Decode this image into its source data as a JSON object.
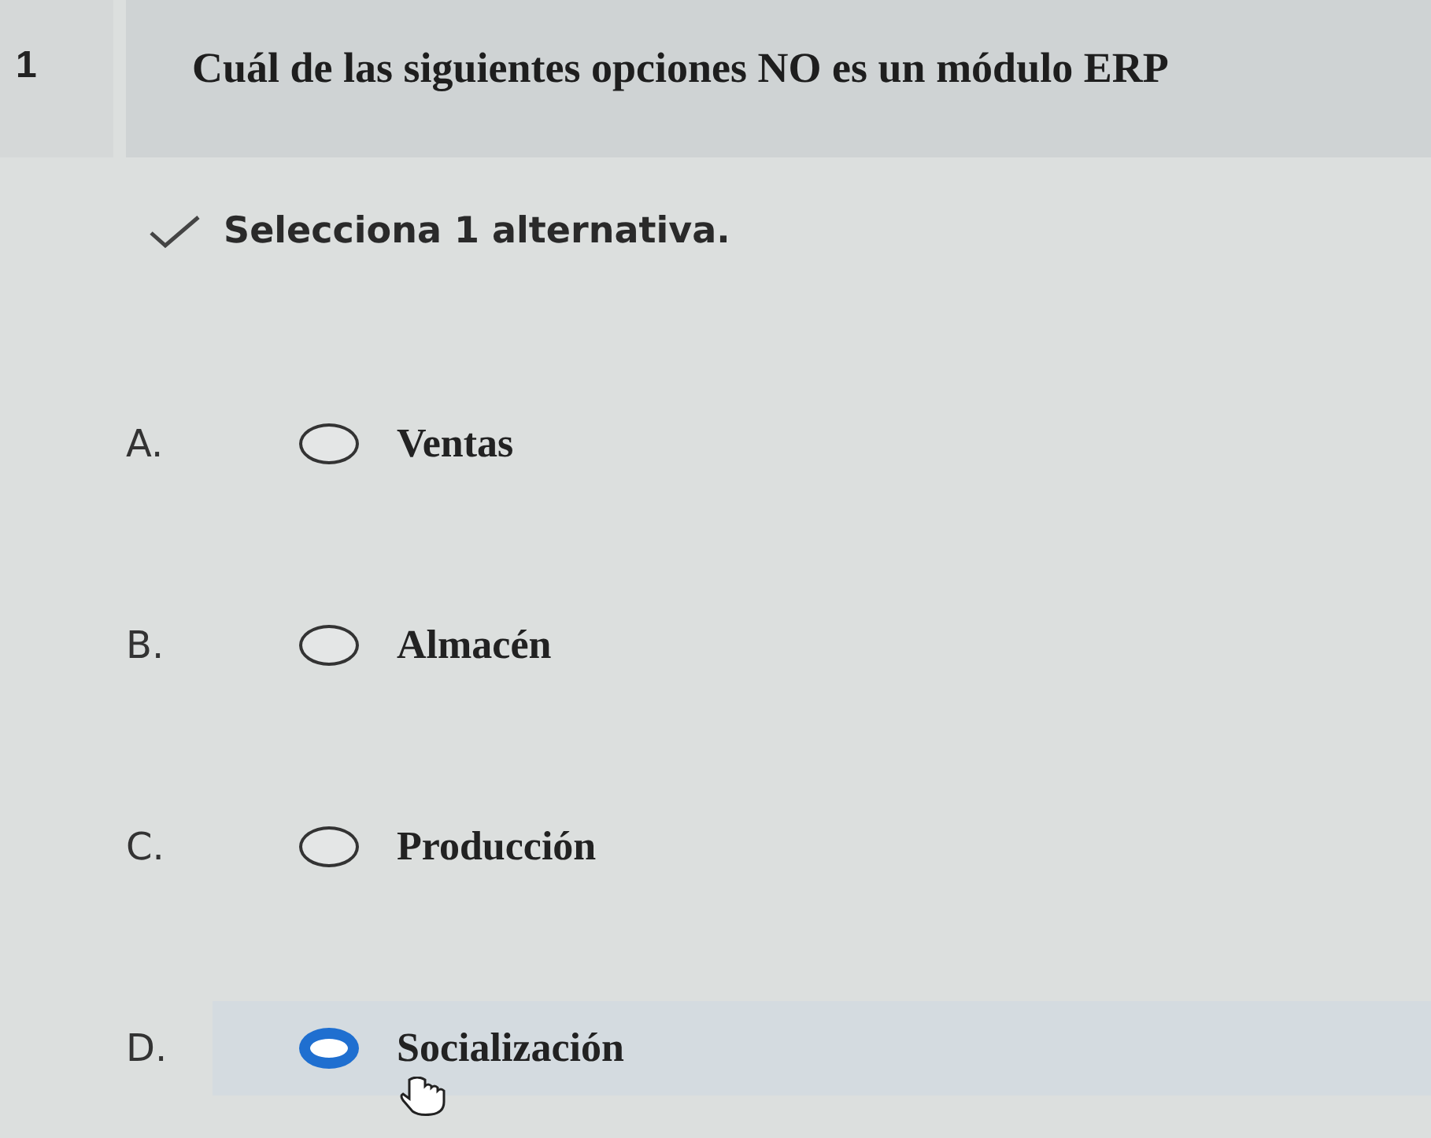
{
  "question": {
    "number": "1",
    "text": "Cuál de las siguientes opciones NO es un módulo ERP"
  },
  "instruction": "Selecciona 1 alternativa.",
  "options": [
    {
      "letter": "A.",
      "text": "Ventas",
      "selected": false
    },
    {
      "letter": "B.",
      "text": "Almacén",
      "selected": false
    },
    {
      "letter": "C.",
      "text": "Producción",
      "selected": false
    },
    {
      "letter": "D.",
      "text": "Socialización",
      "selected": true
    }
  ]
}
